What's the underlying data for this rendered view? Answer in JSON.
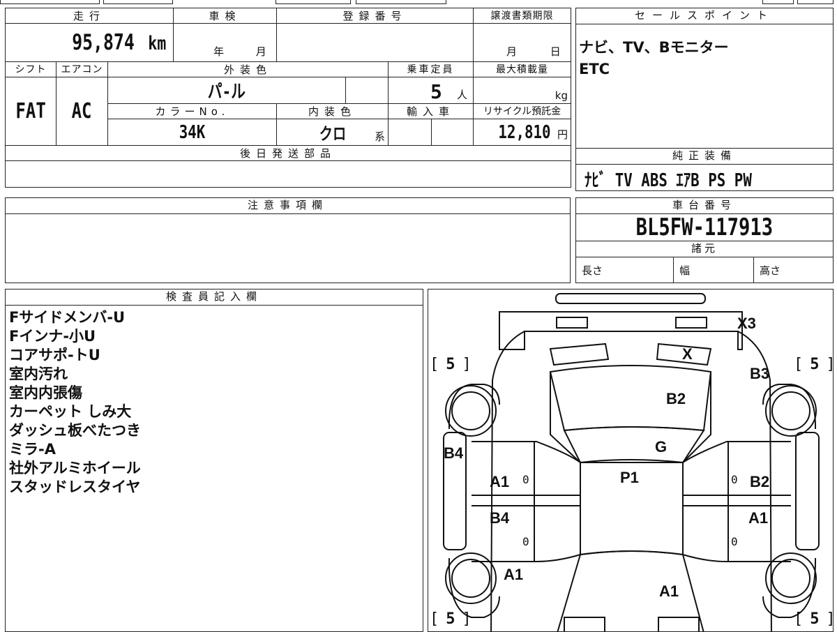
{
  "vehicle": {
    "mileage_label": "走行",
    "mileage": "95,874",
    "mileage_unit": "km",
    "shaken_label": "車検",
    "shaken_year": "年",
    "shaken_month": "月",
    "reg_label": "登録番号",
    "transfer_label": "譲渡書類期限",
    "transfer_month": "月",
    "transfer_day": "日",
    "shift_label": "シフト",
    "shift": "FAT",
    "ac_label": "エアコン",
    "ac": "AC",
    "exterior_label": "外装色",
    "exterior": "パ-ル",
    "seats_label": "乗車定員",
    "seats": "5",
    "seats_unit": "人",
    "maxload_label": "最大積載量",
    "maxload_unit": "kg",
    "color_no_label": "カラーNo.",
    "color_no": "34K",
    "interior_label": "内装色",
    "interior": "クロ",
    "interior_unit": "系",
    "import_label": "輸入車",
    "recycle_label": "リサイクル預託金",
    "recycle": "12,810",
    "recycle_unit": "円",
    "later_parts_label": "後日発送部品"
  },
  "sales_point": {
    "label": "セールスポイント",
    "lines": [
      "ナビ、TV、Bモニター",
      "ETC"
    ]
  },
  "standard_equipment": {
    "label": "純正装備",
    "items": "ﾅﾋﾞ TV ABS ｴｱB PS PW"
  },
  "notes": {
    "label": "注意事項欄"
  },
  "chassis": {
    "label": "車台番号",
    "number": "BL5FW-117913",
    "specs_label": "諸元",
    "length": "長さ",
    "width": "幅",
    "height": "高さ"
  },
  "inspector": {
    "label": "検査員記入欄",
    "lines": [
      "Fサイドメンバ-U",
      "Fインナ-小U",
      "コアサポ-トU",
      "室内汚れ",
      "室内内張傷",
      "カーペット しみ大",
      "ダッシュ板べたつき",
      "ミラ-A",
      "社外アルミホイール",
      "スタッドレスタイヤ"
    ]
  },
  "diagram": {
    "tire_tread": [
      "5",
      "5",
      "5",
      "5"
    ],
    "marks": {
      "rear_bumper": "X3",
      "rear_glass": "X",
      "trunk": "B2",
      "right_rear_fender": "B3",
      "roof": "G",
      "left_rear_quarter": "B4",
      "left_rear_door": "A1",
      "right_rear_door": "B2",
      "roof_center": "P1",
      "left_front_door": "B4",
      "right_front_door": "A1",
      "left_front_fender": "A1",
      "hood": "A1"
    },
    "zeros": [
      "0",
      "0",
      "0",
      "0"
    ]
  }
}
